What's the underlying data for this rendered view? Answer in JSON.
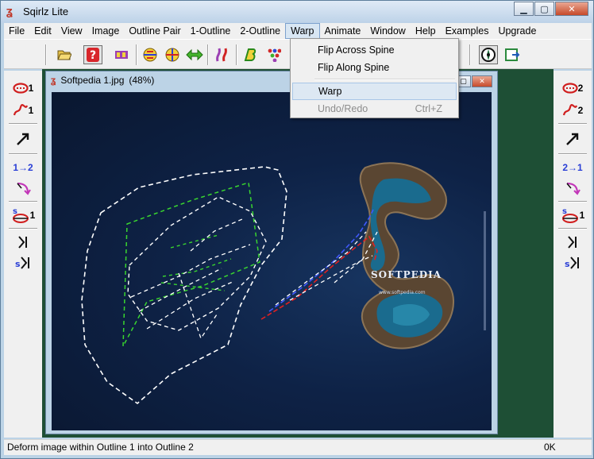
{
  "window": {
    "title": "Sqirlz Lite"
  },
  "menubar": {
    "items": [
      "File",
      "Edit",
      "View",
      "Image",
      "Outline Pair",
      "1-Outline",
      "2-Outline",
      "Warp",
      "Animate",
      "Window",
      "Help",
      "Examples",
      "Upgrade"
    ],
    "active": "Warp"
  },
  "warp_menu": {
    "items": [
      {
        "label": "Flip Across Spine",
        "shortcut": ""
      },
      {
        "label": "Flip Along Spine",
        "shortcut": ""
      },
      {
        "label": "Warp",
        "shortcut": ""
      },
      {
        "label": "Undo/Redo",
        "shortcut": "Ctrl+Z",
        "disabled": true
      }
    ]
  },
  "document": {
    "filename": "Softpedia 1.jpg",
    "zoom": "(48%)"
  },
  "left_tools": {
    "outline1": "1",
    "spine1": "1",
    "copy": "1→2",
    "spine_alt": "1"
  },
  "right_tools": {
    "outline2": "2",
    "spine2": "2",
    "copy": "2→1",
    "spine_alt": "1"
  },
  "image_text": {
    "brand": "SOFTPEDIA",
    "url": "www.softpedia.com",
    "watermark": "SOFTPEDIA",
    "watermark_url": "www.softpedia.com"
  },
  "statusbar": {
    "message": "Deform image within Outline 1 into Outline 2",
    "size": "0K"
  },
  "colors": {
    "outline_white": "#ffffff",
    "outline_green": "#39d62f",
    "spine_red": "#e32020",
    "spine_blue": "#4058ff",
    "workspace_green": "#1e4f35"
  }
}
